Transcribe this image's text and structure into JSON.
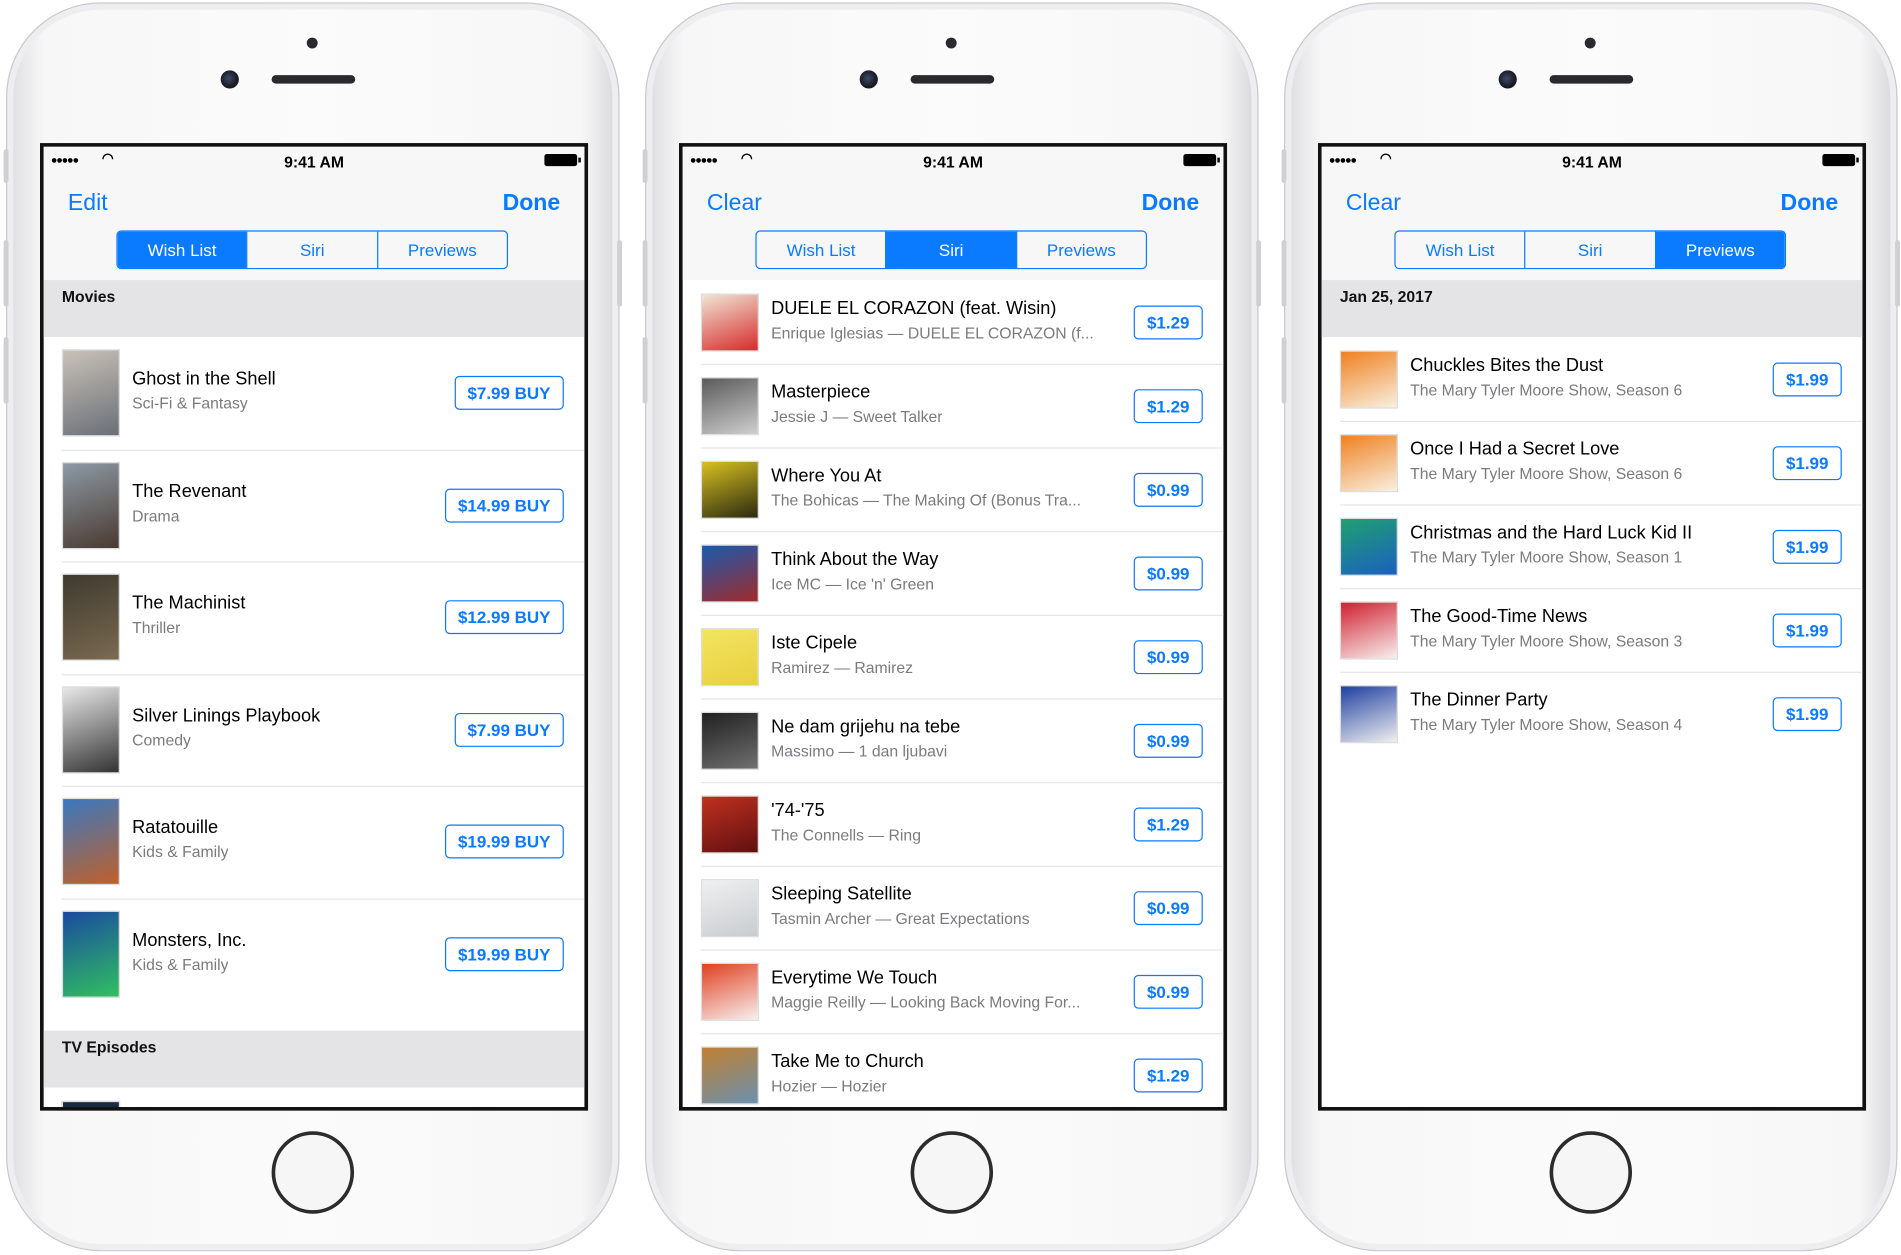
{
  "status_bar": {
    "time": "9:41 AM",
    "signal": "●●●●●",
    "wifi": "wifi-icon"
  },
  "phones": [
    {
      "nav_left": "Edit",
      "nav_right": "Done",
      "segments": [
        "Wish List",
        "Siri",
        "Previews"
      ],
      "active_segment": 0,
      "sections": [
        {
          "header": "Movies",
          "items": [
            {
              "title": "Ghost in the Shell",
              "subtitle": "Sci-Fi & Fantasy",
              "price": "$7.99 BUY",
              "art": [
                "#c9c2b8",
                "#6a6f77"
              ]
            },
            {
              "title": "The Revenant",
              "subtitle": "Drama",
              "price": "$14.99 BUY",
              "art": [
                "#8d9aa6",
                "#4a3a30"
              ]
            },
            {
              "title": "The Machinist",
              "subtitle": "Thriller",
              "price": "$12.99 BUY",
              "art": [
                "#3e3a30",
                "#7a6a50"
              ]
            },
            {
              "title": "Silver Linings Playbook",
              "subtitle": "Comedy",
              "price": "$7.99 BUY",
              "art": [
                "#e8e8e8",
                "#333333"
              ]
            },
            {
              "title": "Ratatouille",
              "subtitle": "Kids & Family",
              "price": "$19.99 BUY",
              "art": [
                "#3a78c0",
                "#c0602a"
              ]
            },
            {
              "title": "Monsters, Inc.",
              "subtitle": "Kids & Family",
              "price": "$19.99 BUY",
              "art": [
                "#1a4aa0",
                "#30c060"
              ]
            }
          ]
        },
        {
          "header": "TV Episodes",
          "items": []
        }
      ]
    },
    {
      "nav_left": "Clear",
      "nav_right": "Done",
      "segments": [
        "Wish List",
        "Siri",
        "Previews"
      ],
      "active_segment": 1,
      "items": [
        {
          "title": "DUELE EL CORAZON (feat. Wisin)",
          "subtitle": "Enrique Iglesias — DUELE EL CORAZON (f...",
          "price": "$1.29",
          "art": [
            "#f0e6d6",
            "#d62a2a"
          ]
        },
        {
          "title": "Masterpiece",
          "subtitle": "Jessie J — Sweet Talker",
          "price": "$1.29",
          "art": [
            "#5a5a5a",
            "#cfcfcf"
          ]
        },
        {
          "title": "Where You At",
          "subtitle": "The Bohicas — The Making Of (Bonus Tra...",
          "price": "$0.99",
          "art": [
            "#d8c020",
            "#2a2a10"
          ]
        },
        {
          "title": "Think About the Way",
          "subtitle": "Ice MC — Ice 'n' Green",
          "price": "$0.99",
          "art": [
            "#1a5ab0",
            "#a02a2a"
          ]
        },
        {
          "title": "Iste Cipele",
          "subtitle": "Ramirez — Ramirez",
          "price": "$0.99",
          "art": [
            "#f2e460",
            "#e8d040"
          ]
        },
        {
          "title": "Ne dam grijehu na tebe",
          "subtitle": "Massimo — 1 dan ljubavi",
          "price": "$0.99",
          "art": [
            "#202020",
            "#707070"
          ]
        },
        {
          "title": "'74-'75",
          "subtitle": "The Connells — Ring",
          "price": "$1.29",
          "art": [
            "#c03020",
            "#601010"
          ]
        },
        {
          "title": "Sleeping Satellite",
          "subtitle": "Tasmin Archer — Great Expectations",
          "price": "$0.99",
          "art": [
            "#f0f0f0",
            "#c8ccd0"
          ]
        },
        {
          "title": "Everytime We Touch",
          "subtitle": "Maggie Reilly — Looking Back Moving For...",
          "price": "$0.99",
          "art": [
            "#e04020",
            "#f8f0f0"
          ]
        },
        {
          "title": "Take Me to Church",
          "subtitle": "Hozier — Hozier",
          "price": "$1.29",
          "art": [
            "#c08030",
            "#6a90b0"
          ]
        }
      ]
    },
    {
      "nav_left": "Clear",
      "nav_right": "Done",
      "segments": [
        "Wish List",
        "Siri",
        "Previews"
      ],
      "active_segment": 2,
      "section_header": "Jan 25, 2017",
      "items": [
        {
          "title": "Chuckles Bites the Dust",
          "subtitle": "The Mary Tyler Moore Show, Season 6",
          "price": "$1.99",
          "art": [
            "#f08020",
            "#f8f0e0"
          ]
        },
        {
          "title": "Once I Had a Secret Love",
          "subtitle": "The Mary Tyler Moore Show, Season 6",
          "price": "$1.99",
          "art": [
            "#f08020",
            "#f8f0e0"
          ]
        },
        {
          "title": "Christmas and the Hard Luck Kid II",
          "subtitle": "The Mary Tyler Moore Show, Season 1",
          "price": "$1.99",
          "art": [
            "#20a070",
            "#1a60c0"
          ]
        },
        {
          "title": "The Good-Time News",
          "subtitle": "The Mary Tyler Moore Show, Season 3",
          "price": "$1.99",
          "art": [
            "#d02030",
            "#f8f0f0"
          ]
        },
        {
          "title": "The Dinner Party",
          "subtitle": "The Mary Tyler Moore Show, Season 4",
          "price": "$1.99",
          "art": [
            "#2040a0",
            "#f0f0f0"
          ]
        }
      ]
    }
  ]
}
